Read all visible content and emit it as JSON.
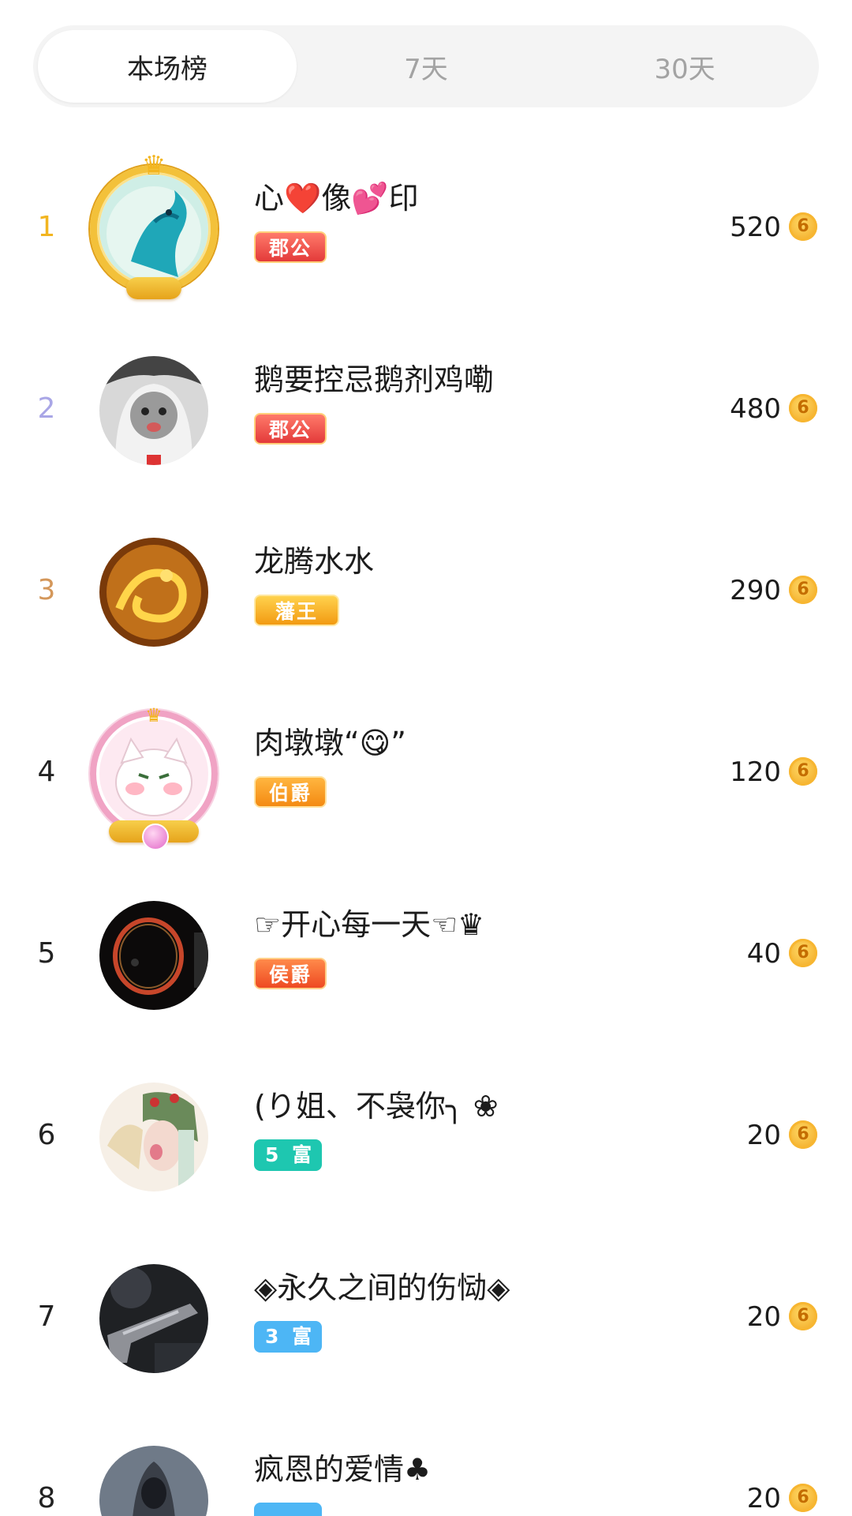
{
  "tabs": [
    {
      "label": "本场榜",
      "active": true
    },
    {
      "label": "7天",
      "active": false
    },
    {
      "label": "30天",
      "active": false
    }
  ],
  "rank_colors": {
    "first": "#f2b520",
    "second": "#a9a6e6",
    "third": "#d4975a",
    "default": "#222222"
  },
  "coin_icon": "6",
  "rows": [
    {
      "rank": "1",
      "name": "心❤️像💕印",
      "badge": "郡公",
      "badge_style": "red",
      "score": "520",
      "avatar_icon": "dragon-avatar",
      "frame": "gold-crown"
    },
    {
      "rank": "2",
      "name": "鹅要控忌鹅剂鸡嘞",
      "badge": "郡公",
      "badge_style": "red",
      "score": "480",
      "avatar_icon": "cat-avatar",
      "frame": "none"
    },
    {
      "rank": "3",
      "name": "龙腾水水",
      "badge": "藩王",
      "badge_style": "gold",
      "score": "290",
      "avatar_icon": "golden-dragon-avatar",
      "frame": "none"
    },
    {
      "rank": "4",
      "name": "肉墩墩“😋”",
      "badge": "伯爵",
      "badge_style": "orange",
      "score": "120",
      "avatar_icon": "white-cat-avatar",
      "frame": "pink-wing"
    },
    {
      "rank": "5",
      "name": "☞开心每一天☜♛",
      "badge": "侯爵",
      "badge_style": "redorange",
      "score": "40",
      "avatar_icon": "ring-avatar",
      "frame": "none"
    },
    {
      "rank": "6",
      "name": "(り姐、不袅你╮ ❀",
      "badge": "5 富",
      "badge_style": "teal",
      "score": "20",
      "avatar_icon": "opera-avatar",
      "frame": "none"
    },
    {
      "rank": "7",
      "name": "◈永久之间的伤恸◈",
      "badge": "3 富",
      "badge_style": "blue",
      "score": "20",
      "avatar_icon": "gun-avatar",
      "frame": "none"
    },
    {
      "rank": "8",
      "name": "疯恩的爱情♣",
      "badge": "",
      "badge_style": "blue",
      "score": "20",
      "avatar_icon": "hooded-figure-avatar",
      "frame": "none"
    }
  ]
}
